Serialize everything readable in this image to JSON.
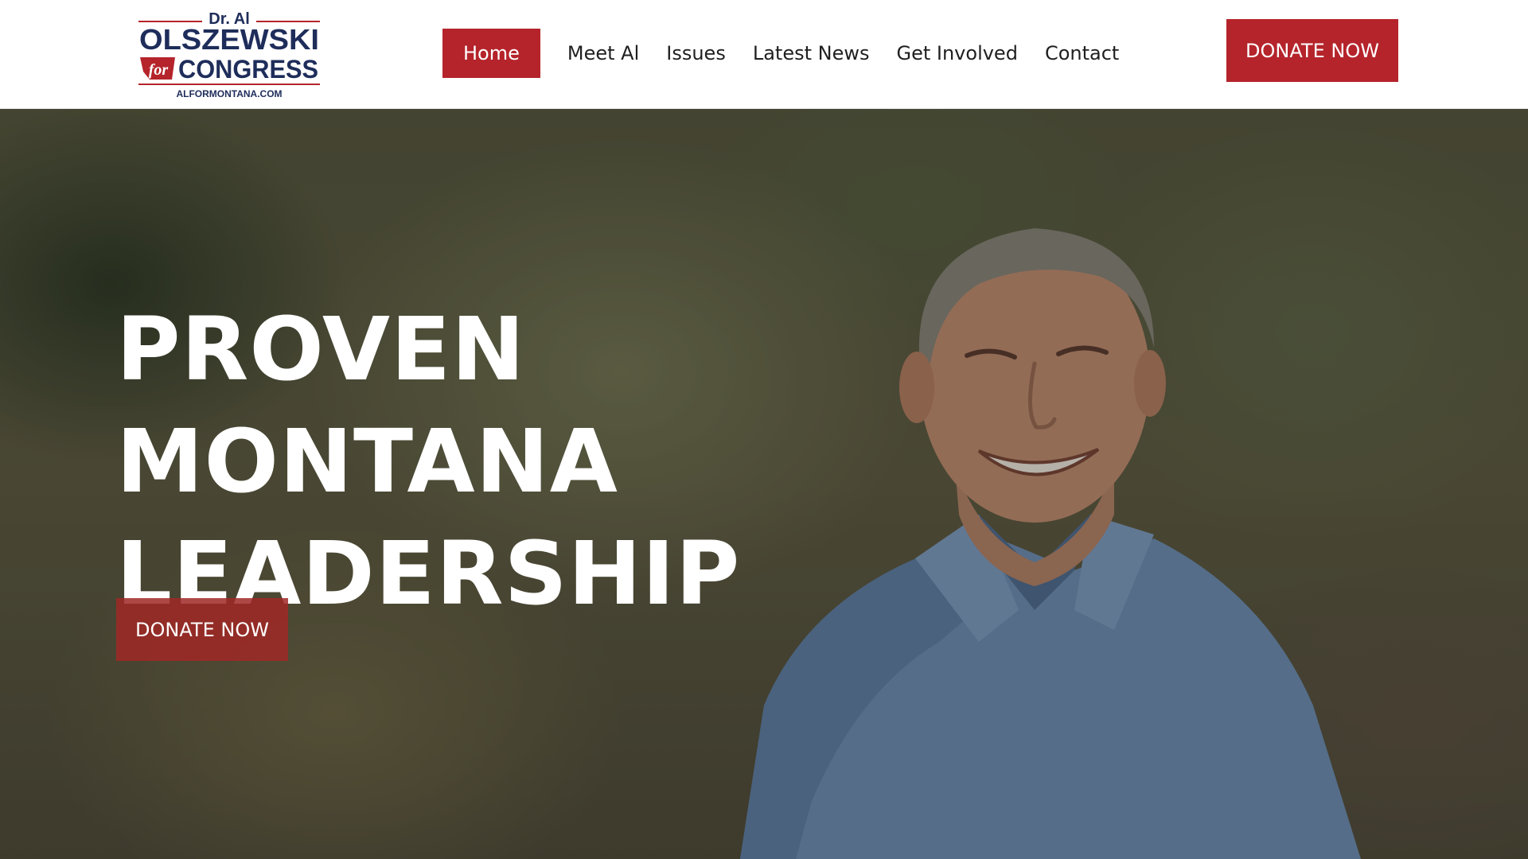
{
  "logo": {
    "top_line": "Dr. Al",
    "name": "OLSZEWSKI",
    "for": "for",
    "congress": "CONGRESS",
    "url": "ALFORMONTANA.COM"
  },
  "nav": {
    "items": [
      {
        "label": "Home",
        "active": true
      },
      {
        "label": "Meet Al",
        "active": false
      },
      {
        "label": "Issues",
        "active": false
      },
      {
        "label": "Latest News",
        "active": false
      },
      {
        "label": "Get Involved",
        "active": false
      },
      {
        "label": "Contact",
        "active": false
      }
    ]
  },
  "header": {
    "donate_label": "DONATE NOW"
  },
  "hero": {
    "headline": [
      "PROVEN",
      "MONTANA",
      "LEADERSHIP"
    ],
    "donate_label": "DONATE NOW",
    "image": "smiling-candidate-portrait"
  },
  "colors": {
    "brand_red": "#b5242b",
    "brand_navy": "#1e2d5a",
    "text_dark": "#1f1f1f"
  }
}
